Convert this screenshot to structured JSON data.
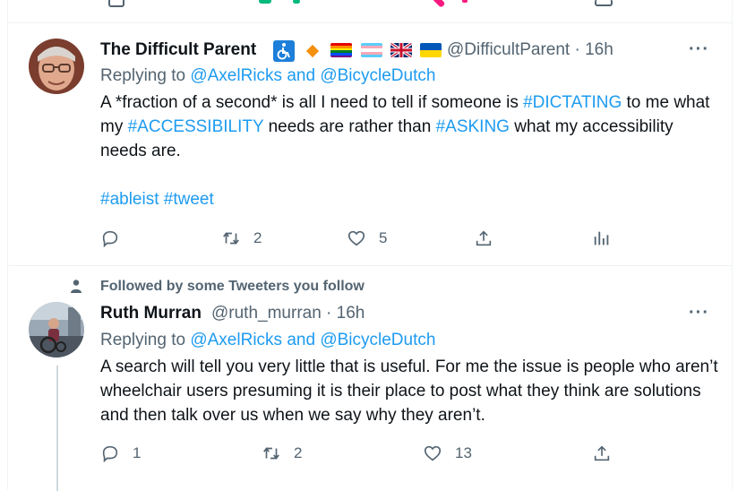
{
  "colors": {
    "accent": "#1d9bf0",
    "muted": "#536471",
    "text": "#0f1419",
    "border": "#eff3f4"
  },
  "tweet1": {
    "name": "The Difficult Parent",
    "handle_time": "@DifficultParent · 16h",
    "reply_prefix": "Replying to ",
    "reply_mention1": "@AxelRicks",
    "reply_and": " and ",
    "reply_mention2": "@BicycleDutch",
    "body": {
      "p1": "A *fraction of a second* is all I need to tell if someone is ",
      "h1": "#DICTATING",
      "p2": " to me what my ",
      "h2": "#ACCESSIBILITY",
      "p3": " needs are rather than ",
      "h3": "#ASKING",
      "p4": " what my accessibility needs are.",
      "h4": "#ableist",
      "h5": "#tweet"
    },
    "retweets": "2",
    "likes": "5",
    "more": "···",
    "badges": [
      "wheelchair-icon",
      "orange-diamond-icon",
      "rainbow-flag-icon",
      "trans-flag-icon",
      "uk-flag-icon",
      "ukraine-flag-icon"
    ]
  },
  "tweet2": {
    "social_context": "Followed by some Tweeters you follow",
    "name": "Ruth Murran",
    "handle_time": "@ruth_murran · 16h",
    "reply_prefix": "Replying to ",
    "reply_mention1": "@AxelRicks",
    "reply_and": " and ",
    "reply_mention2": "@BicycleDutch",
    "body": "A search will tell you very little that is useful. For me the issue is people who aren’t wheelchair users presuming it is their place to post what they think are solutions and then talk over us when we say why they aren’t.",
    "replies": "1",
    "retweets": "2",
    "likes": "13",
    "more": "···"
  }
}
